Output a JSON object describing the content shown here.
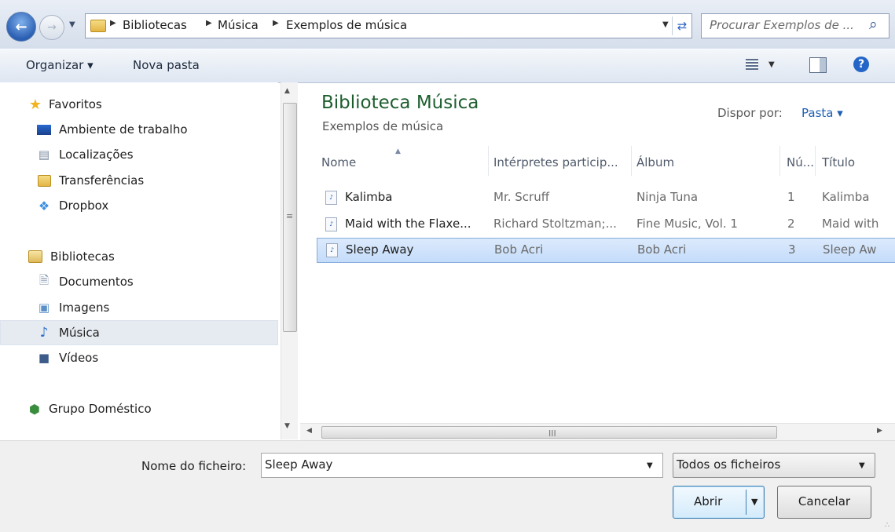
{
  "address": {
    "breadcrumbs": [
      "Bibliotecas",
      "Música",
      "Exemplos de música"
    ],
    "search_placeholder": "Procurar Exemplos de ..."
  },
  "toolbar": {
    "organize": "Organizar ▾",
    "new_folder": "Nova pasta",
    "help": "?"
  },
  "nav": {
    "favorites": "Favoritos",
    "desktop": "Ambiente de trabalho",
    "locations": "Localizações",
    "downloads": "Transferências",
    "dropbox": "Dropbox",
    "libraries": "Bibliotecas",
    "documents": "Documentos",
    "images": "Imagens",
    "music": "Música",
    "videos": "Vídeos",
    "homegroup": "Grupo Doméstico"
  },
  "library": {
    "title": "Biblioteca Música",
    "subtitle": "Exemplos de música",
    "arrange_label": "Dispor por:",
    "arrange_value": "Pasta ▾"
  },
  "columns": [
    "Nome",
    "Intérpretes particip...",
    "Álbum",
    "Nú...",
    "Título"
  ],
  "files": [
    {
      "name": "Kalimba",
      "artist": "Mr. Scruff",
      "album": "Ninja Tuna",
      "num": "1",
      "title": "Kalimba"
    },
    {
      "name": "Maid with the Flaxe...",
      "artist": "Richard Stoltzman;...",
      "album": "Fine Music, Vol. 1",
      "num": "2",
      "title": "Maid with"
    },
    {
      "name": "Sleep Away",
      "artist": "Bob Acri",
      "album": "Bob Acri",
      "num": "3",
      "title": "Sleep Aw"
    }
  ],
  "scrollbar": {
    "grip": "III",
    "side_grip": "≡"
  },
  "bottom": {
    "filename_label": "Nome do ficheiro:",
    "filename_value": "Sleep Away",
    "filter_value": "Todos os ficheiros",
    "open": "Abrir",
    "cancel": "Cancelar"
  }
}
